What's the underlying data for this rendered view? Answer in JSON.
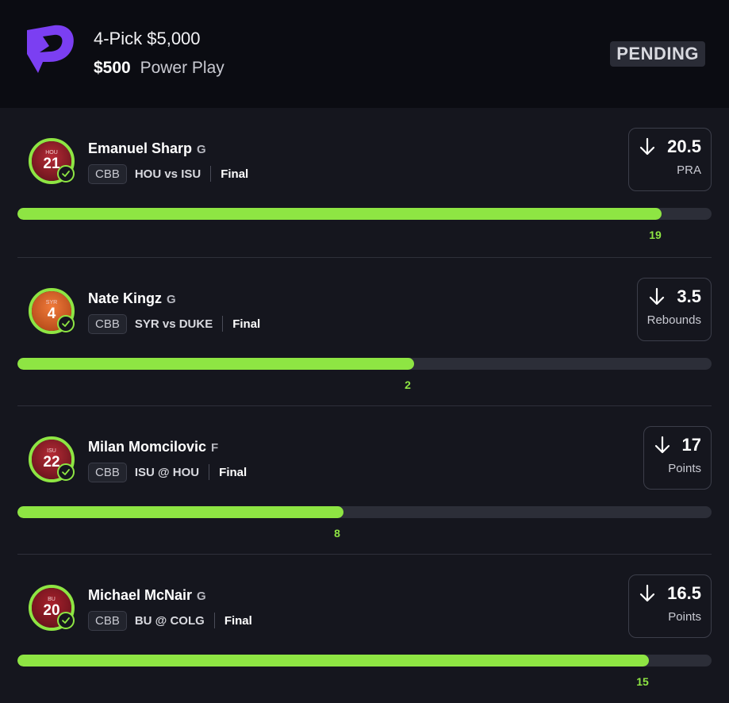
{
  "header": {
    "title": "4-Pick $5,000",
    "entry_amount": "$500",
    "entry_type": "Power Play",
    "status": "PENDING"
  },
  "colors": {
    "accent": "#8ee543",
    "brand": "#7b3ff2",
    "track": "#2c2e38"
  },
  "picks": [
    {
      "player": "Emanuel Sharp",
      "position": "G",
      "jersey_team": "HOU",
      "jersey_number": "21",
      "jersey_color": "#b52a35",
      "league": "CBB",
      "game": "HOU vs ISU",
      "status": "Final",
      "direction": "under",
      "line": "20.5",
      "stat": "PRA",
      "current": "19",
      "progress": 0.928
    },
    {
      "player": "Nate Kingz",
      "position": "G",
      "jersey_team": "SYR",
      "jersey_number": "4",
      "jersey_color": "#e2652a",
      "league": "CBB",
      "game": "SYR vs DUKE",
      "status": "Final",
      "direction": "under",
      "line": "3.5",
      "stat": "Rebounds",
      "current": "2",
      "progress": 0.571
    },
    {
      "player": "Milan Momcilovic",
      "position": "F",
      "jersey_team": "ISU",
      "jersey_number": "22",
      "jersey_color": "#b52a35",
      "league": "CBB",
      "game": "ISU @ HOU",
      "status": "Final",
      "direction": "under",
      "line": "17",
      "stat": "Points",
      "current": "8",
      "progress": 0.47
    },
    {
      "player": "Michael McNair",
      "position": "G",
      "jersey_team": "BU",
      "jersey_number": "20",
      "jersey_color": "#a8202c",
      "league": "CBB",
      "game": "BU @ COLG",
      "status": "Final",
      "direction": "under",
      "line": "16.5",
      "stat": "Points",
      "current": "15",
      "progress": 0.91
    }
  ]
}
